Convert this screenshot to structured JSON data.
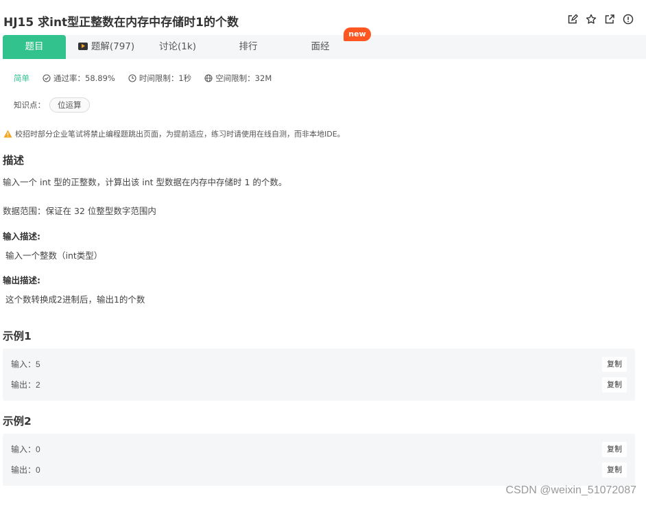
{
  "header": {
    "title": "HJ15  求int型正整数在内存中存储时1的个数",
    "icons": [
      "edit-icon",
      "star-icon",
      "share-icon",
      "info-icon"
    ]
  },
  "tabs": [
    {
      "label": "题目",
      "active": true
    },
    {
      "label": "题解(797)",
      "icon": "video-icon"
    },
    {
      "label": "讨论(1k)"
    },
    {
      "label": "排行"
    },
    {
      "label": "面经",
      "badge": "new"
    }
  ],
  "meta": {
    "difficulty": "简单",
    "pass_rate": "通过率：58.89%",
    "time_limit": "时间限制：1秒",
    "space_limit": "空间限制：32M"
  },
  "knowledge": {
    "label": "知识点：",
    "tag": "位运算"
  },
  "notice": "校招时部分企业笔试将禁止编程题跳出页面，为提前适应，练习时请使用在线自测，而非本地IDE。",
  "description": {
    "heading": "描述",
    "text": "输入一个 int 型的正整数，计算出该 int 型数据在内存中存储时 1 的个数。",
    "range": "数据范围：保证在 32 位整型数字范围内"
  },
  "input_desc": {
    "heading": "输入描述:",
    "text": "输入一个整数（int类型）"
  },
  "output_desc": {
    "heading": "输出描述:",
    "text": "这个数转换成2进制后，输出1的个数"
  },
  "examples": [
    {
      "heading": "示例1",
      "input_label": "输入：",
      "input": "5",
      "output_label": "输出：",
      "output": "2",
      "copy": "复制"
    },
    {
      "heading": "示例2",
      "input_label": "输入：",
      "input": "0",
      "output_label": "输出：",
      "output": "0",
      "copy": "复制"
    }
  ],
  "watermark": "CSDN @weixin_51072087",
  "colors": {
    "accent": "#32c28e",
    "badge": "#ff5722",
    "panel": "#f5f6f8"
  }
}
